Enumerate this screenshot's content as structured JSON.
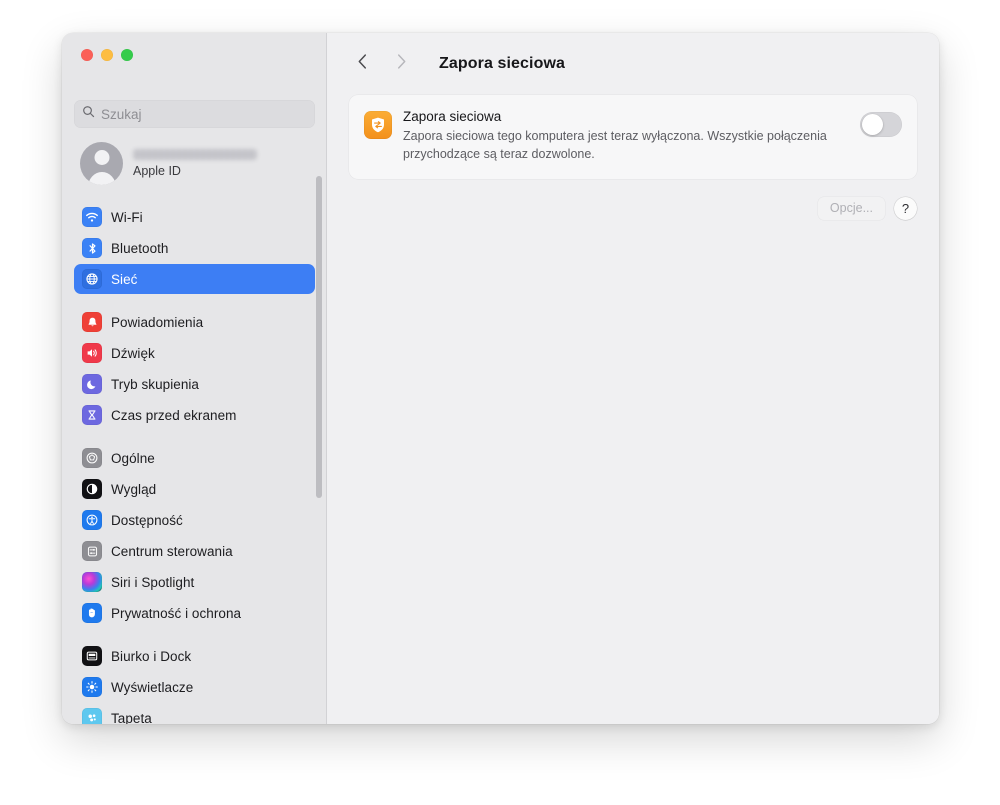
{
  "window": {
    "traffic_lights": [
      {
        "name": "close",
        "color": "#fb6058"
      },
      {
        "name": "minimize",
        "color": "#fdbd41"
      },
      {
        "name": "zoom",
        "color": "#35cc4b"
      }
    ]
  },
  "search": {
    "placeholder": "Szukaj",
    "value": "",
    "icon": "search-icon"
  },
  "account": {
    "name_redacted": true,
    "subtitle": "Apple ID",
    "avatar_icon": "person-avatar-icon"
  },
  "sidebar": {
    "groups": [
      {
        "items": [
          {
            "label": "Wi-Fi",
            "icon": "wifi-icon",
            "color": "#3b82f6",
            "selected": false
          },
          {
            "label": "Bluetooth",
            "icon": "bluetooth-icon",
            "color": "#3b82f6",
            "selected": false
          },
          {
            "label": "Sieć",
            "icon": "globe-icon",
            "color": "#3b82f6",
            "selected": true
          }
        ]
      },
      {
        "items": [
          {
            "label": "Powiadomienia",
            "icon": "bell-icon",
            "color": "#ef4037",
            "selected": false
          },
          {
            "label": "Dźwięk",
            "icon": "speaker-icon",
            "color": "#f0394a",
            "selected": false
          },
          {
            "label": "Tryb skupienia",
            "icon": "moon-icon",
            "color": "#6d68e0",
            "selected": false
          },
          {
            "label": "Czas przed ekranem",
            "icon": "hourglass-icon",
            "color": "#6d68e0",
            "selected": false
          }
        ]
      },
      {
        "items": [
          {
            "label": "Ogólne",
            "icon": "gear-icon",
            "color": "#8e8e93",
            "selected": false
          },
          {
            "label": "Wygląd",
            "icon": "appearance-icon",
            "color": "#111114",
            "selected": false
          },
          {
            "label": "Dostępność",
            "icon": "accessibility-icon",
            "color": "#1f7aee",
            "selected": false
          },
          {
            "label": "Centrum sterowania",
            "icon": "control-center-icon",
            "color": "#8e8e93",
            "selected": false
          },
          {
            "label": "Siri i Spotlight",
            "icon": "siri-icon",
            "color": "#6b2fa0",
            "selected": false
          },
          {
            "label": "Prywatność i ochrona",
            "icon": "hand-icon",
            "color": "#1f7aee",
            "selected": false
          }
        ]
      },
      {
        "items": [
          {
            "label": "Biurko i Dock",
            "icon": "desktop-dock-icon",
            "color": "#111114",
            "selected": false
          },
          {
            "label": "Wyświetlacze",
            "icon": "brightness-icon",
            "color": "#1f7aee",
            "selected": false
          },
          {
            "label": "Tapeta",
            "icon": "wallpaper-icon",
            "color": "#5ec8ef",
            "selected": false
          }
        ]
      }
    ]
  },
  "nav": {
    "back_icon": "chevron-left-icon",
    "forward_icon": "chevron-right-icon",
    "title": "Zapora sieciowa"
  },
  "firewall_card": {
    "icon": "firewall-shield-icon",
    "title": "Zapora sieciowa",
    "description": "Zapora sieciowa tego komputera jest teraz wyłączona. Wszystkie połączenia przychodzące są teraz dozwolone.",
    "toggle_state": "off"
  },
  "buttons": {
    "options_label": "Opcje...",
    "options_enabled": false,
    "help_label": "?"
  }
}
